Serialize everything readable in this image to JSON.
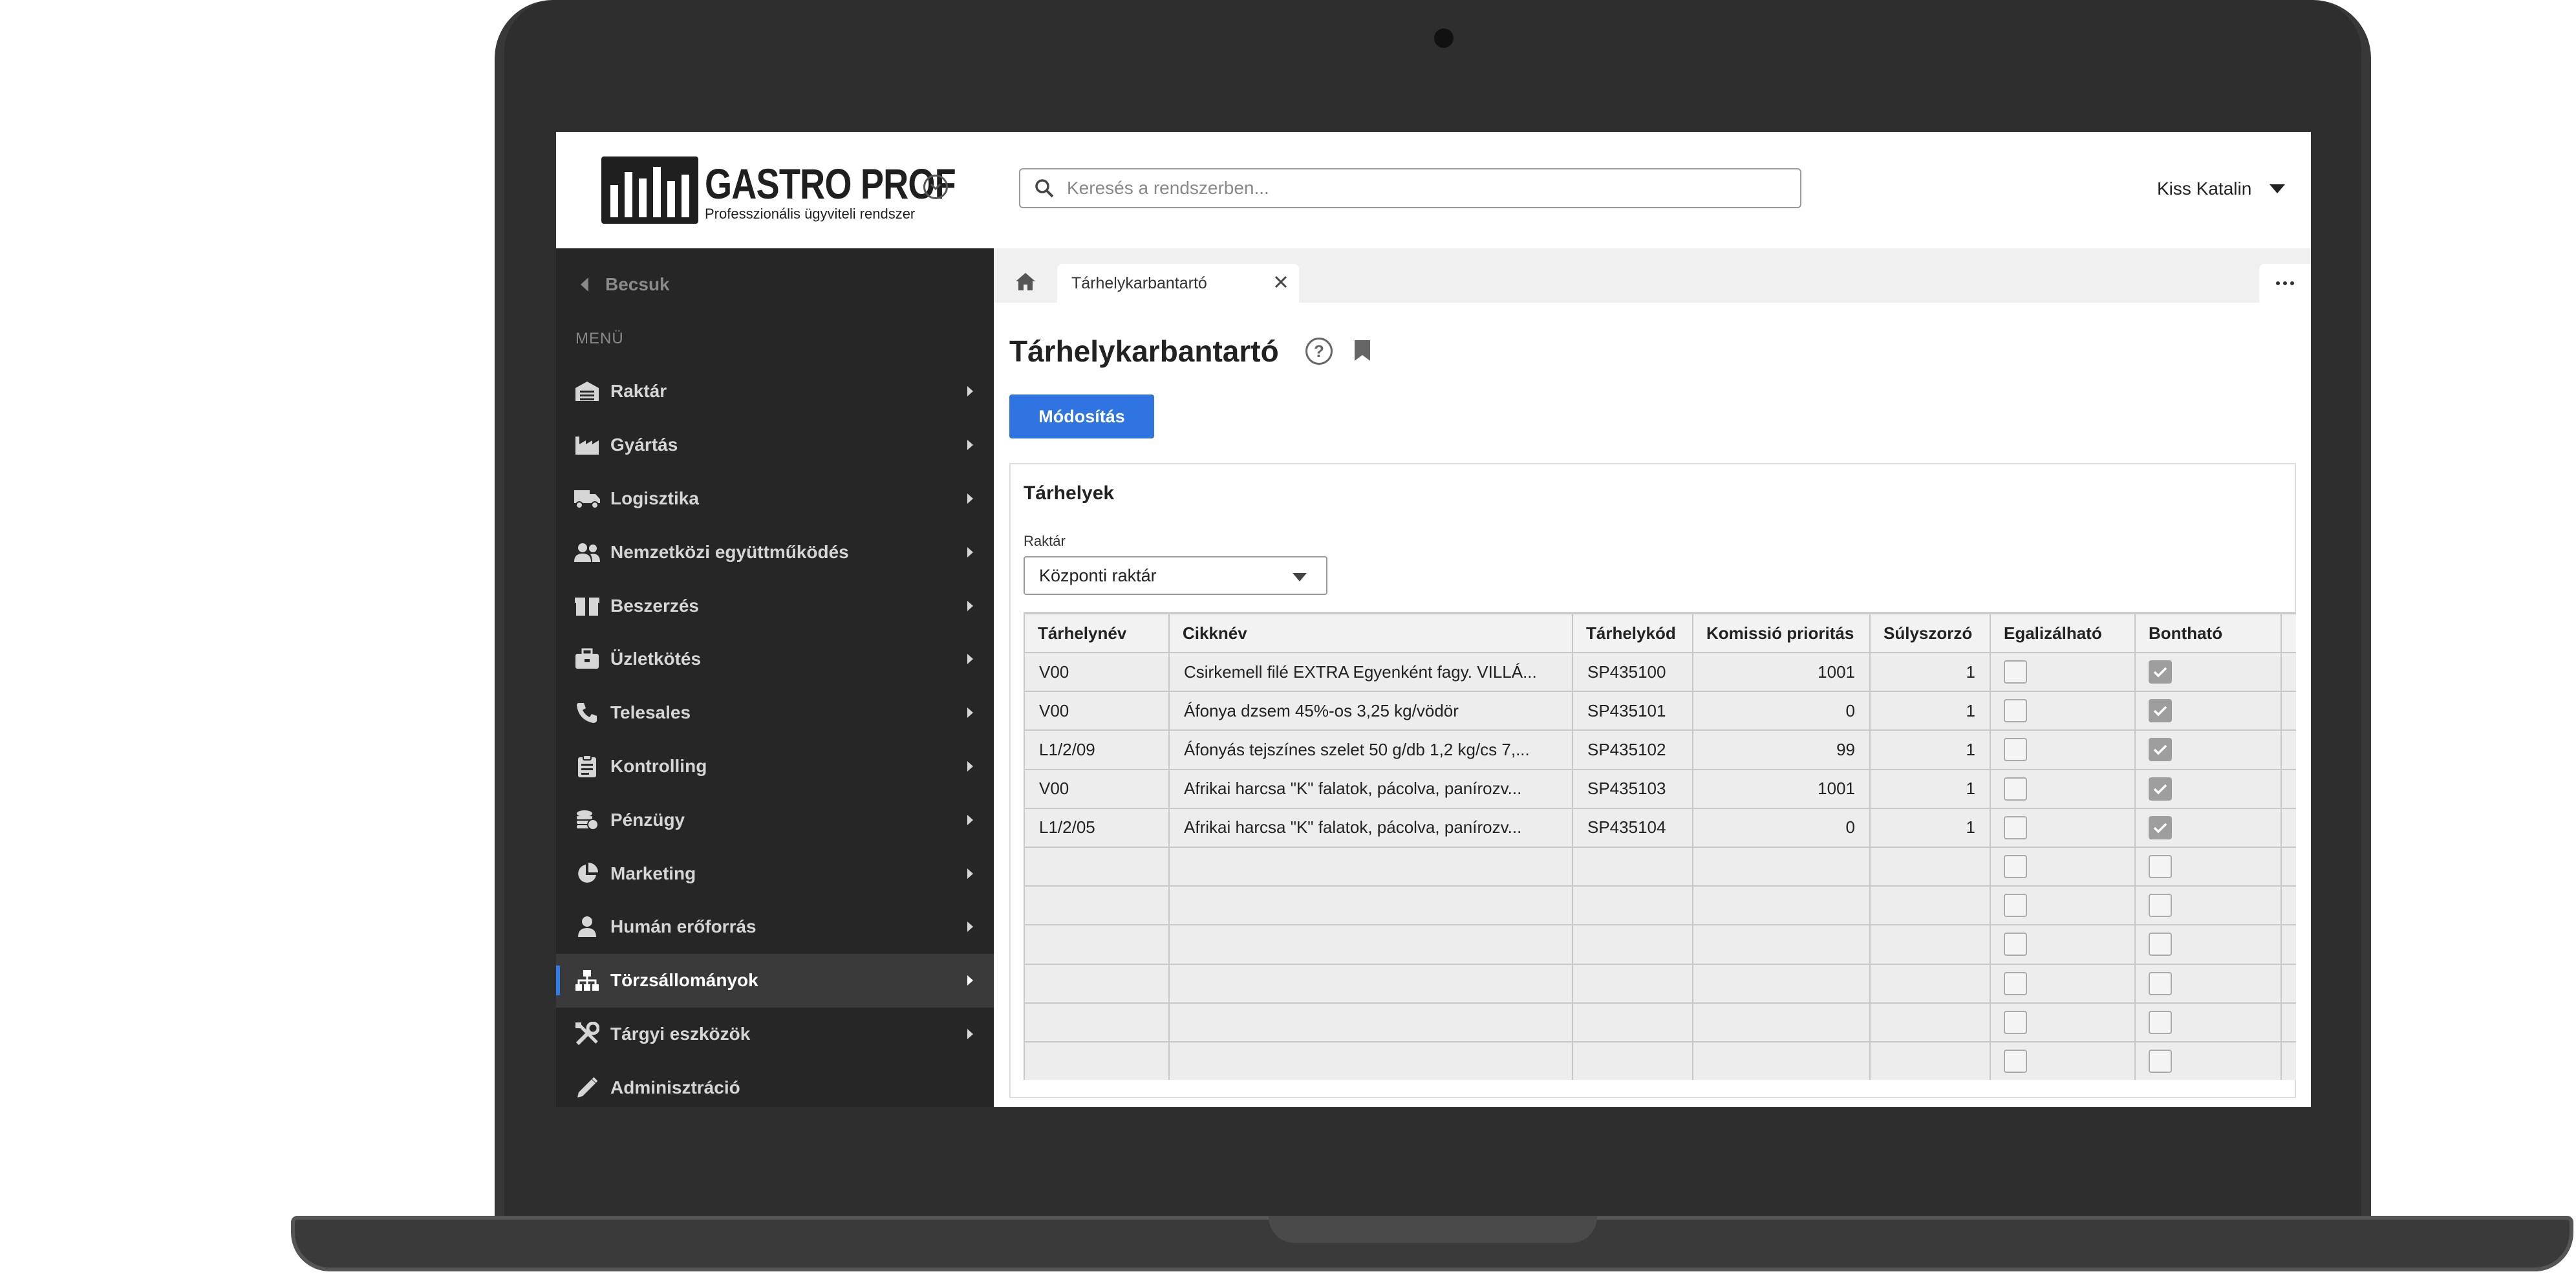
{
  "app": {
    "logo_title": "GASTRO PROF",
    "logo_subtitle": "Professzionális ügyviteli rendszer",
    "accent_color": "#2f74e0"
  },
  "header": {
    "search_placeholder": "Keresés a rendszerben...",
    "user_name": "Kiss Katalin"
  },
  "sidebar": {
    "back_label": "Becsuk",
    "menu_label": "MENÜ",
    "items": [
      {
        "label": "Raktár",
        "icon": "warehouse-icon"
      },
      {
        "label": "Gyártás",
        "icon": "industry-icon"
      },
      {
        "label": "Logisztika",
        "icon": "truck-icon"
      },
      {
        "label": "Nemzetközi együttműködés",
        "icon": "users-icon"
      },
      {
        "label": "Beszerzés",
        "icon": "box-icon"
      },
      {
        "label": "Üzletkötés",
        "icon": "briefcase-icon"
      },
      {
        "label": "Telesales",
        "icon": "phone-icon"
      },
      {
        "label": "Kontrolling",
        "icon": "clipboard-icon"
      },
      {
        "label": "Pénzügy",
        "icon": "coins-icon"
      },
      {
        "label": "Marketing",
        "icon": "pie-chart-icon"
      },
      {
        "label": "Humán erőforrás",
        "icon": "user-icon"
      },
      {
        "label": "Törzsállományok",
        "icon": "sitemap-icon",
        "active": true
      },
      {
        "label": "Tárgyi eszközök",
        "icon": "tools-icon"
      },
      {
        "label": "Adminisztráció",
        "icon": "pencil-icon"
      }
    ]
  },
  "tabs": {
    "active_tab": "Tárhelykarbantartó"
  },
  "page": {
    "title": "Tárhelykarbantartó",
    "modify_button": "Módosítás"
  },
  "panel": {
    "title": "Tárhelyek",
    "warehouse_label": "Raktár",
    "warehouse_value": "Központi raktár"
  },
  "grid": {
    "columns": [
      "Tárhelynév",
      "Cikknév",
      "Tárhelykód",
      "Komissió prioritás",
      "Súlyszorzó",
      "Egalizálható",
      "Bontható"
    ],
    "rows": [
      {
        "name": "V00",
        "item": "Csirkemell filé EXTRA Egyenként fagy. VILLÁ...",
        "code": "SP435100",
        "priority": "1001",
        "weight": "1",
        "egal": false,
        "bont": true
      },
      {
        "name": "V00",
        "item": "Áfonya dzsem 45%-os 3,25 kg/vödör",
        "code": "SP435101",
        "priority": "0",
        "weight": "1",
        "egal": false,
        "bont": true
      },
      {
        "name": "L1/2/09",
        "item": "Áfonyás tejszínes szelet 50 g/db 1,2 kg/cs 7,...",
        "code": "SP435102",
        "priority": "99",
        "weight": "1",
        "egal": false,
        "bont": true
      },
      {
        "name": "V00",
        "item": "Afrikai harcsa  \"K\" falatok, pácolva, panírozv...",
        "code": "SP435103",
        "priority": "1001",
        "weight": "1",
        "egal": false,
        "bont": true
      },
      {
        "name": "L1/2/05",
        "item": "Afrikai harcsa  \"K\" falatok, pácolva, panírozv...",
        "code": "SP435104",
        "priority": "0",
        "weight": "1",
        "egal": false,
        "bont": true
      }
    ],
    "empty_rows": 6
  }
}
